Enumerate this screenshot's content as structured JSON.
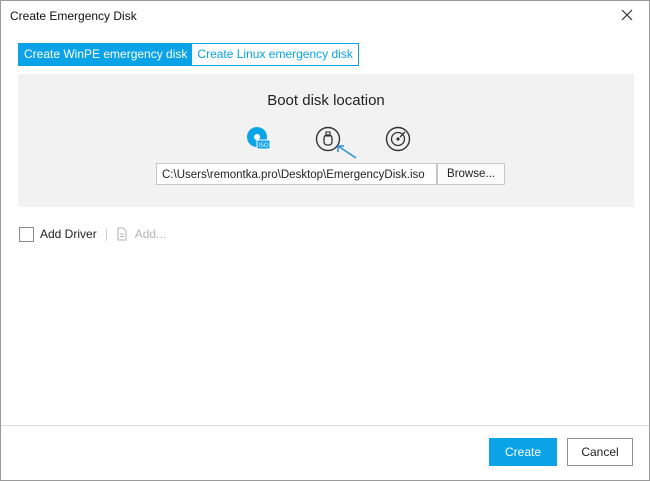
{
  "window": {
    "title": "Create Emergency Disk"
  },
  "tabs": [
    {
      "label": "Create WinPE emergency disk",
      "active": true
    },
    {
      "label": "Create Linux emergency disk",
      "active": false
    }
  ],
  "panel": {
    "title": "Boot disk location",
    "media_options": [
      {
        "icon": "iso-disc-icon",
        "selected": true
      },
      {
        "icon": "usb-drive-icon",
        "selected": false
      },
      {
        "icon": "cd-dvd-icon",
        "selected": false
      }
    ],
    "path_value": "C:\\Users\\remontka.pro\\Desktop\\EmergencyDisk.iso",
    "browse_label": "Browse..."
  },
  "driver": {
    "label": "Add Driver",
    "checked": false,
    "add_label": "Add..."
  },
  "footer": {
    "create_label": "Create",
    "cancel_label": "Cancel"
  },
  "colors": {
    "accent": "#0aa3e8",
    "panel_bg": "#f2f2f2"
  }
}
